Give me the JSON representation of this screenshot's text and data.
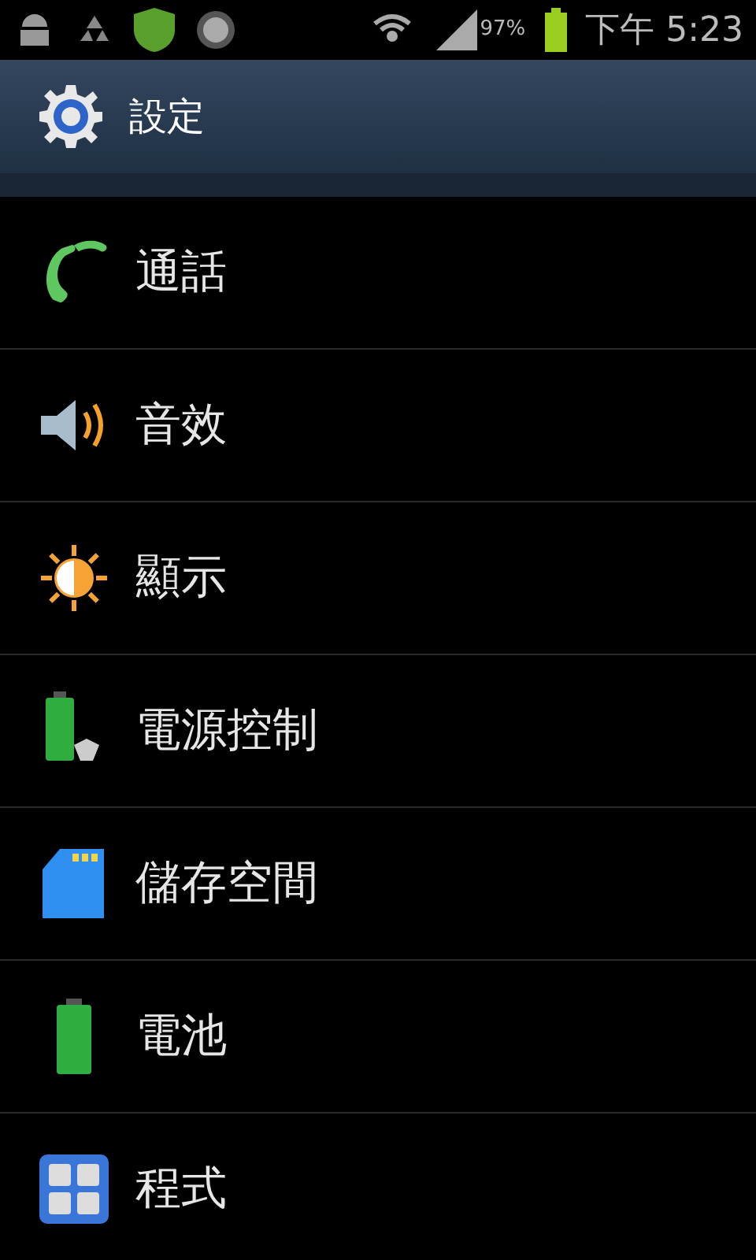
{
  "status_bar": {
    "battery_text": "97%",
    "time": "下午 5:23"
  },
  "header": {
    "title": "設定"
  },
  "items": [
    {
      "label": "通話"
    },
    {
      "label": "音效"
    },
    {
      "label": "顯示"
    },
    {
      "label": "電源控制"
    },
    {
      "label": "儲存空間"
    },
    {
      "label": "電池"
    },
    {
      "label": "程式"
    }
  ]
}
